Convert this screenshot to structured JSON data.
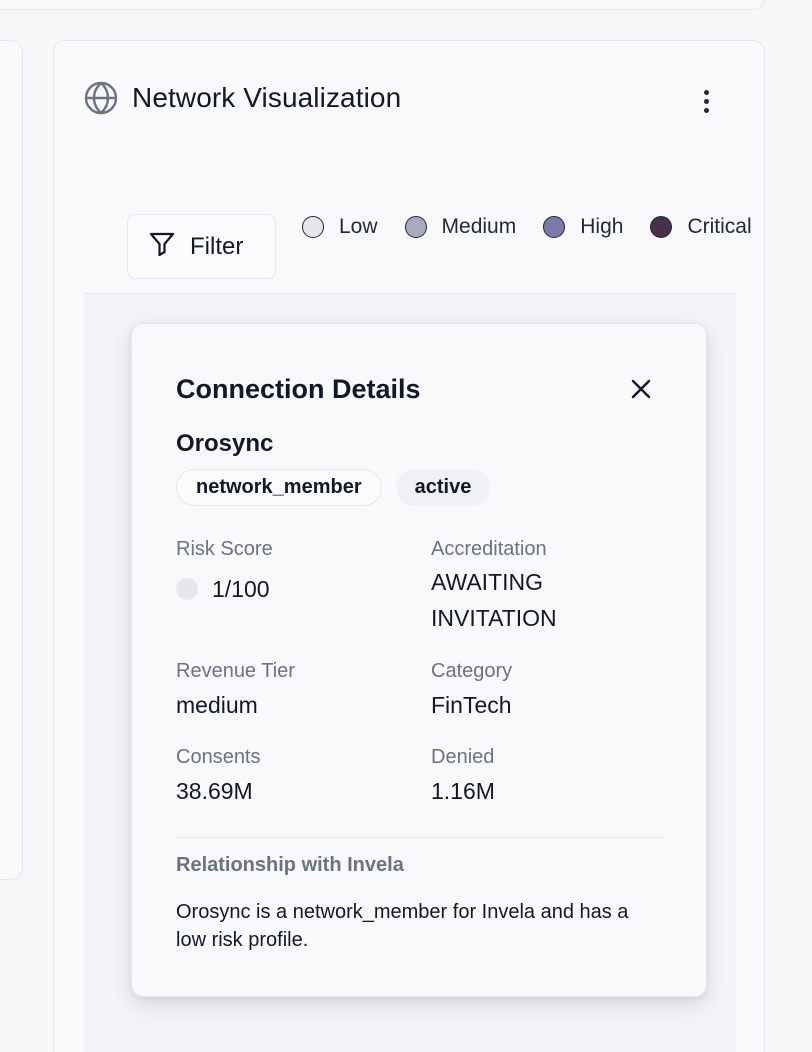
{
  "panel": {
    "title": "Network Visualization",
    "globe_icon": "globe-icon",
    "more_icon": "more-vertical-icon"
  },
  "toolbar": {
    "filter_label": "Filter",
    "filter_icon": "filter-icon"
  },
  "legend": {
    "items": [
      {
        "label": "Low",
        "color": "#e5e7eb"
      },
      {
        "label": "Medium",
        "color": "#a9abbd"
      },
      {
        "label": "High",
        "color": "#7c7aa6"
      },
      {
        "label": "Critical",
        "color": "#4a2f4d"
      }
    ]
  },
  "details": {
    "title": "Connection Details",
    "close_icon": "close-icon",
    "org_name": "Orosync",
    "badges": [
      "network_member",
      "active"
    ],
    "risk_score": {
      "label": "Risk Score",
      "value": "1/100",
      "dot_color": "#e5e7eb"
    },
    "accreditation": {
      "label": "Accreditation",
      "value_line1": "AWAITING",
      "value_line2": "INVITATION"
    },
    "revenue_tier": {
      "label": "Revenue Tier",
      "value": "medium"
    },
    "category": {
      "label": "Category",
      "value": "FinTech"
    },
    "consents": {
      "label": "Consents",
      "value": "38.69M"
    },
    "denied": {
      "label": "Denied",
      "value": "1.16M"
    },
    "relationship": {
      "title": "Relationship with Invela",
      "text": "Orosync is a network_member for Invela and has a low risk profile."
    }
  }
}
